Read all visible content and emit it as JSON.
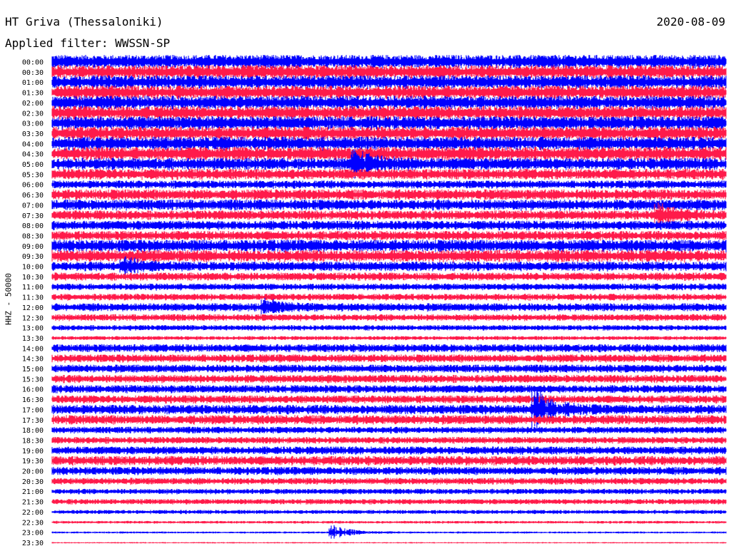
{
  "header": {
    "station": "HT Griva (Thessaloniki)",
    "date": "2020-08-09",
    "filter": "Applied filter: WWSSN-SP"
  },
  "chart_data": {
    "type": "line",
    "title": "HT Griva (Thessaloniki)",
    "subtitle": "Applied filter: WWSSN-SP",
    "ylabel": "HHZ - 50000",
    "row_labels": [
      "00:00",
      "00:30",
      "01:00",
      "01:30",
      "02:00",
      "02:30",
      "03:00",
      "03:30",
      "04:00",
      "04:30",
      "05:00",
      "05:30",
      "06:00",
      "06:30",
      "07:00",
      "07:30",
      "08:00",
      "08:30",
      "09:00",
      "09:30",
      "10:00",
      "10:30",
      "11:00",
      "11:30",
      "12:00",
      "12:30",
      "13:00",
      "13:30",
      "14:00",
      "14:30",
      "15:00",
      "15:30",
      "16:00",
      "16:30",
      "17:00",
      "17:30",
      "18:00",
      "18:30",
      "19:00",
      "19:30",
      "20:00",
      "20:30",
      "21:00",
      "21:30",
      "22:00",
      "22:30",
      "23:00",
      "23:30"
    ],
    "series_colors": [
      "#0000ff",
      "#ff1a4a"
    ],
    "amplitude_per_row": [
      10,
      10,
      10,
      10,
      10,
      10,
      10,
      10,
      10,
      10,
      9,
      8,
      6,
      8,
      8,
      7,
      7,
      7,
      9,
      9,
      7,
      6,
      5,
      5,
      6,
      5,
      4,
      3,
      6,
      6,
      6,
      6,
      6,
      6,
      7,
      7,
      5,
      5,
      6,
      7,
      6,
      5,
      4,
      4,
      3,
      2,
      1.5,
      1
    ],
    "events": [
      {
        "row": "05:00",
        "minute": 13.5,
        "amplitude": 18
      },
      {
        "row": "07:30",
        "minute": 27,
        "amplitude": 14
      },
      {
        "row": "10:00",
        "minute": 3.2,
        "amplitude": 12
      },
      {
        "row": "12:00",
        "minute": 9.5,
        "amplitude": 10
      },
      {
        "row": "17:00",
        "minute": 21.5,
        "amplitude": 30
      },
      {
        "row": "23:00",
        "minute": 12.5,
        "amplitude": 10
      }
    ]
  }
}
